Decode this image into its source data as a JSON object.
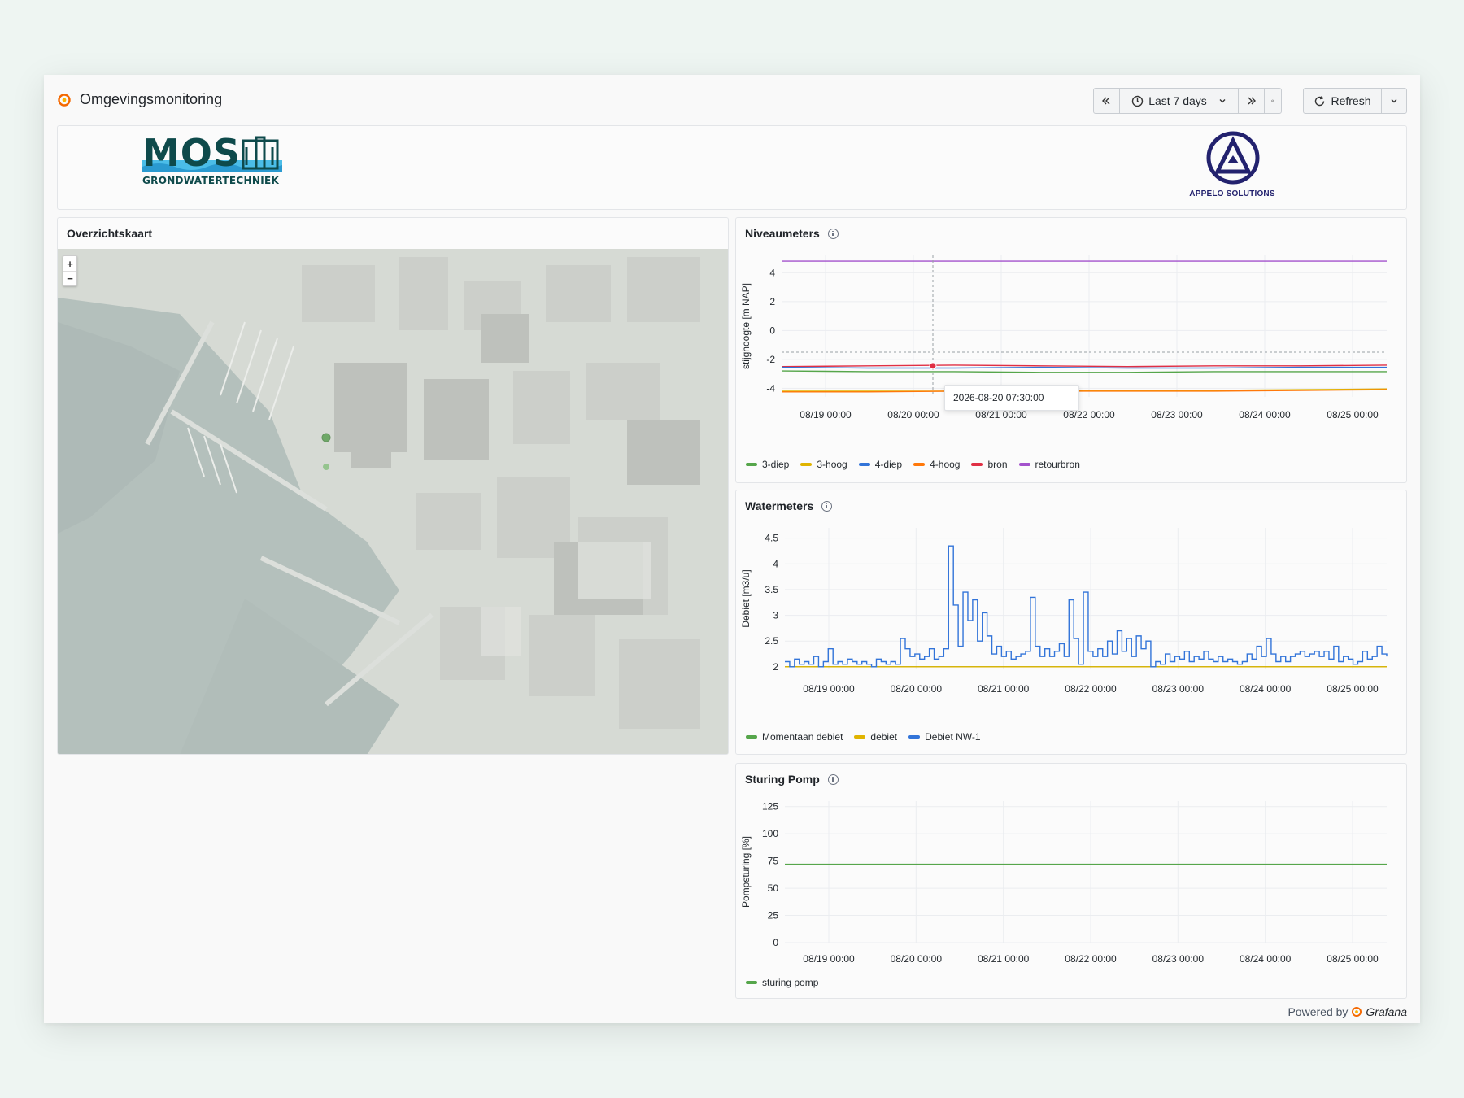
{
  "dashboard": {
    "title": "Omgevingsmonitoring"
  },
  "toolbar": {
    "time_range": "Last 7 days",
    "refresh_label": "Refresh"
  },
  "logos": {
    "left": {
      "big": "MOS",
      "sub": "GRONDWATERTECHNIEK"
    },
    "right": {
      "name": "APPELO SOLUTIONS"
    }
  },
  "map_panel": {
    "title": "Overzichtskaart",
    "zoom_in": "+",
    "zoom_out": "−"
  },
  "niveau_panel": {
    "title": "Niveaumeters",
    "tooltip": "2026-08-20 07:30:00",
    "legend": [
      {
        "label": "3-diep",
        "color": "#56a64b"
      },
      {
        "label": "3-hoog",
        "color": "#e0b400"
      },
      {
        "label": "4-diep",
        "color": "#3274d9"
      },
      {
        "label": "4-hoog",
        "color": "#ff780a"
      },
      {
        "label": "bron",
        "color": "#e02f44"
      },
      {
        "label": "retourbron",
        "color": "#a352cc"
      }
    ]
  },
  "water_panel": {
    "title": "Watermeters",
    "legend": [
      {
        "label": "Momentaan debiet",
        "color": "#56a64b"
      },
      {
        "label": "debiet",
        "color": "#e0b400"
      },
      {
        "label": "Debiet NW-1",
        "color": "#3274d9"
      }
    ]
  },
  "pomp_panel": {
    "title": "Sturing Pomp",
    "legend": [
      {
        "label": "sturing pomp",
        "color": "#56a64b"
      }
    ]
  },
  "footer": {
    "powered_by": "Powered by",
    "brand": "Grafana"
  },
  "chart_data": [
    {
      "type": "line",
      "title": "Niveaumeters",
      "ylabel": "stijghoogte [m NAP]",
      "ylim": [
        -4.6,
        5.2
      ],
      "yticks": [
        4,
        2,
        0,
        -2,
        -4
      ],
      "xticks": [
        "08/19 00:00",
        "08/20 00:00",
        "08/21 00:00",
        "08/22 00:00",
        "08/23 00:00",
        "08/24 00:00",
        "08/25 00:00"
      ],
      "series": [
        {
          "name": "retourbron",
          "color": "#a352cc",
          "values": [
            4.8,
            4.8,
            4.8,
            4.8,
            4.8,
            4.8,
            4.8,
            4.8
          ]
        },
        {
          "name": "bron",
          "color": "#e02f44",
          "values": [
            -2.5,
            -2.45,
            -2.4,
            -2.45,
            -2.5,
            -2.45,
            -2.45,
            -2.4
          ]
        },
        {
          "name": "4-diep",
          "color": "#3274d9",
          "values": [
            -2.55,
            -2.6,
            -2.6,
            -2.55,
            -2.6,
            -2.6,
            -2.55,
            -2.55
          ]
        },
        {
          "name": "3-diep",
          "color": "#56a64b",
          "values": [
            -2.8,
            -2.85,
            -2.85,
            -2.9,
            -2.9,
            -2.85,
            -2.85,
            -2.85
          ]
        },
        {
          "name": "3-hoog",
          "color": "#e0b400",
          "values": [
            -4.2,
            -4.2,
            -4.2,
            -4.15,
            -4.15,
            -4.15,
            -4.1,
            -4.05
          ]
        },
        {
          "name": "4-hoog",
          "color": "#ff780a",
          "values": [
            -4.25,
            -4.25,
            -4.2,
            -4.2,
            -4.2,
            -4.2,
            -4.15,
            -4.1
          ]
        }
      ]
    },
    {
      "type": "line",
      "title": "Watermeters",
      "ylabel": "Debiet [m3/u]",
      "ylim": [
        1.95,
        4.7
      ],
      "yticks": [
        4.5,
        4,
        3.5,
        3,
        2.5,
        2
      ],
      "xticks": [
        "08/19 00:00",
        "08/20 00:00",
        "08/21 00:00",
        "08/22 00:00",
        "08/23 00:00",
        "08/24 00:00",
        "08/25 00:00"
      ],
      "series": [
        {
          "name": "Momentaan debiet",
          "color": "#56a64b",
          "values": [
            2,
            2,
            2,
            2,
            2,
            2,
            2,
            2
          ]
        },
        {
          "name": "debiet",
          "color": "#e0b400",
          "values": [
            2,
            2,
            2,
            2,
            2,
            2,
            2,
            2
          ]
        },
        {
          "name": "Debiet NW-1",
          "color": "#3274d9",
          "values": [
            2.1,
            2.0,
            2.15,
            2.05,
            2.1,
            2.05,
            2.2,
            2.0,
            2.1,
            2.35,
            2.05,
            2.1,
            2.05,
            2.15,
            2.1,
            2.05,
            2.1,
            2.05,
            2.0,
            2.15,
            2.1,
            2.05,
            2.1,
            2.05,
            2.55,
            2.35,
            2.2,
            2.25,
            2.15,
            2.2,
            2.35,
            2.15,
            2.2,
            2.35,
            4.35,
            3.2,
            2.4,
            3.45,
            2.9,
            3.3,
            2.5,
            3.05,
            2.6,
            2.25,
            2.4,
            2.2,
            2.3,
            2.15,
            2.2,
            2.25,
            2.3,
            3.35,
            2.4,
            2.2,
            2.35,
            2.2,
            2.3,
            2.45,
            2.2,
            3.3,
            2.55,
            2.05,
            3.45,
            2.3,
            2.2,
            2.35,
            2.2,
            2.5,
            2.25,
            2.7,
            2.3,
            2.55,
            2.2,
            2.6,
            2.35,
            2.5,
            2.0,
            2.1,
            2.05,
            2.25,
            2.1,
            2.2,
            2.15,
            2.3,
            2.1,
            2.2,
            2.15,
            2.3,
            2.15,
            2.1,
            2.2,
            2.1,
            2.15,
            2.1,
            2.05,
            2.1,
            2.25,
            2.15,
            2.4,
            2.2,
            2.55,
            2.25,
            2.1,
            2.2,
            2.1,
            2.2,
            2.25,
            2.3,
            2.2,
            2.25,
            2.3,
            2.2,
            2.3,
            2.15,
            2.4,
            2.1,
            2.2,
            2.15,
            2.05,
            2.1,
            2.3,
            2.15,
            2.2,
            2.4,
            2.25,
            2.2
          ]
        }
      ]
    },
    {
      "type": "line",
      "title": "Sturing Pomp",
      "ylabel": "Pompsturing [%]",
      "ylim": [
        0,
        130
      ],
      "yticks": [
        125,
        100,
        75,
        50,
        25,
        0
      ],
      "xticks": [
        "08/19 00:00",
        "08/20 00:00",
        "08/21 00:00",
        "08/22 00:00",
        "08/23 00:00",
        "08/24 00:00",
        "08/25 00:00"
      ],
      "series": [
        {
          "name": "sturing pomp",
          "color": "#56a64b",
          "values": [
            72,
            72,
            72,
            72,
            72,
            72,
            72,
            72
          ]
        }
      ]
    }
  ]
}
